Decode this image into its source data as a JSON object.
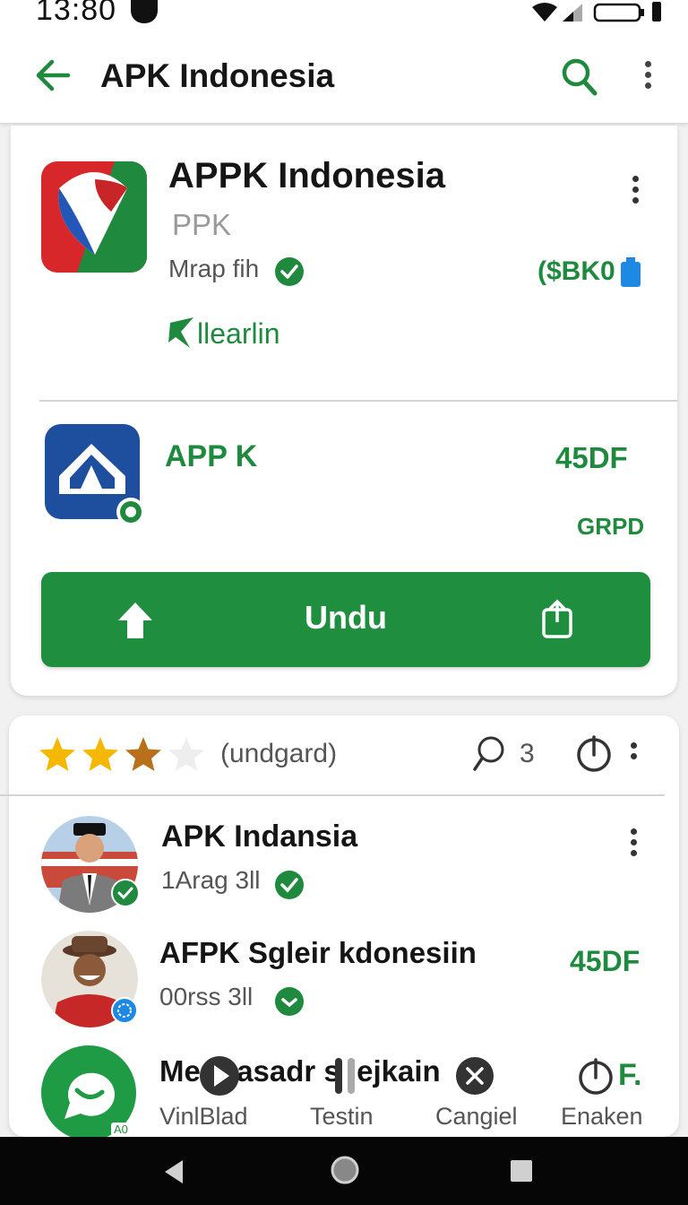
{
  "status_bar": {
    "time": "13:80"
  },
  "app_bar": {
    "title": "APK Indonesia"
  },
  "app_header": {
    "name": "APPK Indonesia",
    "subtitle": "PPK",
    "developer": "Mrap fih",
    "price": "($BK0",
    "tag": "llearlin"
  },
  "app_secondary": {
    "name": "APP K",
    "right_value": "45DF",
    "right_sub": "GRPD"
  },
  "install_button": {
    "label": "Undu"
  },
  "rating": {
    "stars": 3,
    "label": "(undgard)",
    "search_count": "3"
  },
  "list": [
    {
      "title": "APK Indansia",
      "subtitle": "1Arag 3ll",
      "right": ""
    },
    {
      "title": "AFPK Sgleir kdonesiin",
      "subtitle": "00rss 3ll",
      "right": "45DF"
    },
    {
      "title": "Me lPasadr s lejkain",
      "subtitle": "",
      "right": "F.",
      "badge": "A0"
    }
  ],
  "bottom_actions": [
    {
      "label": "VinlBlad",
      "icon": "play-icon"
    },
    {
      "label": "Testin",
      "icon": "pause-icon"
    },
    {
      "label": "Cangiel",
      "icon": "close-icon"
    },
    {
      "label": "Enaken",
      "icon": "power-icon"
    }
  ],
  "colors": {
    "accent": "#1f8e3f",
    "verified": "#1f8a3e",
    "text_primary": "#161616",
    "text_secondary": "#666666"
  }
}
